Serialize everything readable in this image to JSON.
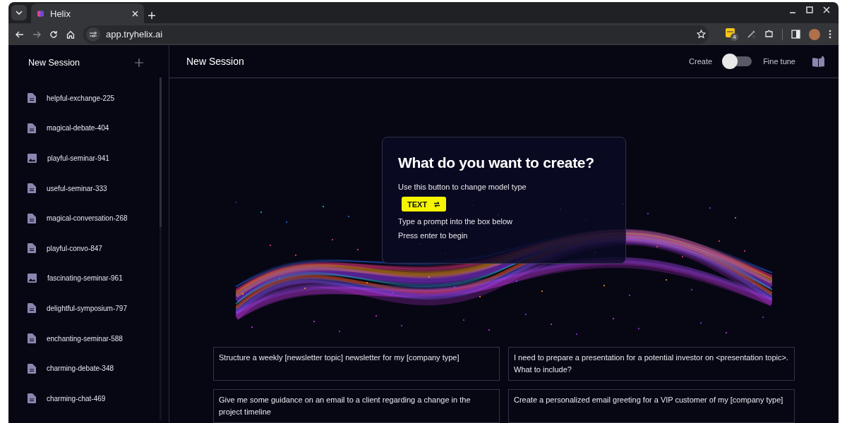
{
  "browser": {
    "tab": {
      "title": "Helix"
    },
    "url": "app.tryhelix.ai",
    "extension_badge": "4"
  },
  "sidebar": {
    "title": "New Session",
    "items": [
      {
        "label": "helpful-exchange-225",
        "kind": "text"
      },
      {
        "label": "magical-debate-404",
        "kind": "text"
      },
      {
        "label": "playful-seminar-941",
        "kind": "image"
      },
      {
        "label": "useful-seminar-333",
        "kind": "text"
      },
      {
        "label": "magical-conversation-268",
        "kind": "text"
      },
      {
        "label": "playful-convo-847",
        "kind": "text"
      },
      {
        "label": "fascinating-seminar-961",
        "kind": "image"
      },
      {
        "label": "delightful-symposium-797",
        "kind": "text"
      },
      {
        "label": "enchanting-seminar-588",
        "kind": "text"
      },
      {
        "label": "charming-debate-348",
        "kind": "text"
      },
      {
        "label": "charming-chat-469",
        "kind": "text"
      }
    ]
  },
  "header": {
    "title": "New Session",
    "mode_left": "Create",
    "mode_right": "Fine tune",
    "fine_tune": {
      "on": false
    }
  },
  "intro": {
    "title": "What do you want to create?",
    "hint": "Use this button to change model type",
    "type_button": "TEXT",
    "lines": [
      "Type a prompt into the box below",
      "Press enter to begin"
    ]
  },
  "prompts": [
    {
      "text": "Structure a weekly [newsletter topic] newsletter for my [company type]"
    },
    {
      "text": "I need to prepare a presentation for a potential investor on <presentation topic>. What to include?"
    },
    {
      "text": "Give me some guidance on an email to a client regarding a change in the project timeline"
    },
    {
      "text": "Create a personalized email greeting for a VIP customer of my [company type]"
    }
  ]
}
